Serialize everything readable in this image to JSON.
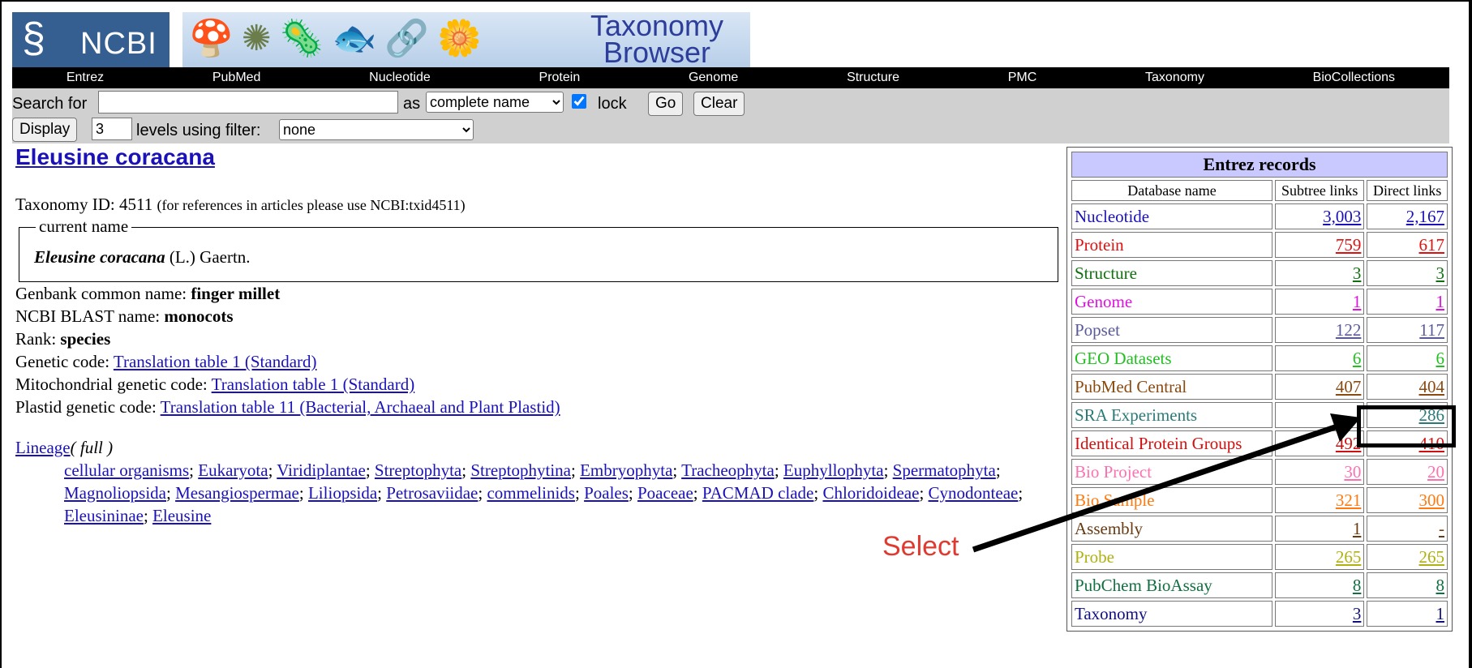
{
  "header": {
    "logo_text": "NCBI",
    "banner_title_line1": "Taxonomy",
    "banner_title_line2": "Browser"
  },
  "nav": [
    "Entrez",
    "PubMed",
    "Nucleotide",
    "Protein",
    "Genome",
    "Structure",
    "PMC",
    "Taxonomy",
    "BioCollections"
  ],
  "search": {
    "label": "Search for",
    "input_value": "",
    "as_label": "as",
    "as_select": "complete name",
    "lock_label": "lock",
    "lock_checked": true,
    "go": "Go",
    "clear": "Clear",
    "display": "Display",
    "levels_value": "3",
    "levels_label": "levels using filter:",
    "filter_select": "none"
  },
  "main": {
    "title": "Eleusine coracana",
    "taxonomy_id_label": "Taxonomy ID: 4511",
    "taxonomy_id_note": "(for references in articles please use NCBI:txid4511)",
    "current_name_legend": "current name",
    "current_name_bold": "Eleusine coracana",
    "current_name_author": "(L.) Gaertn.",
    "genbank_label": "Genbank common name: ",
    "genbank_value": "finger millet",
    "blast_label": "NCBI BLAST name: ",
    "blast_value": "monocots",
    "rank_label": "Rank: ",
    "rank_value": "species",
    "genetic_label": "Genetic code: ",
    "genetic_value": "Translation table 1 (Standard)",
    "mito_label": "Mitochondrial genetic code: ",
    "mito_value": "Translation table 1 (Standard)",
    "plastid_label": "Plastid genetic code: ",
    "plastid_value": "Translation table 11 (Bacterial, Archaeal and Plant Plastid)",
    "lineage_label": "Lineage",
    "lineage_full": "( full )",
    "lineage": [
      "cellular organisms",
      "Eukaryota",
      "Viridiplantae",
      "Streptophyta",
      "Streptophytina",
      "Embryophyta",
      "Tracheophyta",
      "Euphyllophyta",
      "Spermatophyta",
      "Magnoliopsida",
      "Mesangiospermae",
      "Liliopsida",
      "Petrosaviidae",
      "commelinids",
      "Poales",
      "Poaceae",
      "PACMAD clade",
      "Chloridoideae",
      "Cynodonteae",
      "Eleusininae",
      "Eleusine"
    ]
  },
  "entrez": {
    "title": "Entrez records",
    "col_db": "Database name",
    "col_subtree": "Subtree links",
    "col_direct": "Direct links",
    "rows": [
      {
        "name": "Nucleotide",
        "subtree": "3,003",
        "direct": "2,167",
        "color": "#1a12b8"
      },
      {
        "name": "Protein",
        "subtree": "759",
        "direct": "617",
        "color": "#e01010"
      },
      {
        "name": "Structure",
        "subtree": "3",
        "direct": "3",
        "color": "#107010"
      },
      {
        "name": "Genome",
        "subtree": "1",
        "direct": "1",
        "color": "#e010e0"
      },
      {
        "name": "Popset",
        "subtree": "122",
        "direct": "117",
        "color": "#5a5a9a"
      },
      {
        "name": "GEO Datasets",
        "subtree": "6",
        "direct": "6",
        "color": "#20c020"
      },
      {
        "name": "PubMed Central",
        "subtree": "407",
        "direct": "404",
        "color": "#8a4a10"
      },
      {
        "name": "SRA Experiments",
        "subtree": "",
        "direct": "286",
        "color": "#2a7a7a"
      },
      {
        "name": "Identical Protein Groups",
        "subtree": "492",
        "direct": "410",
        "color": "#d01010"
      },
      {
        "name": "Bio Project",
        "subtree": "30",
        "direct": "20",
        "color": "#ff70b0"
      },
      {
        "name": "Bio Sample",
        "subtree": "321",
        "direct": "300",
        "color": "#ff7a10"
      },
      {
        "name": "Assembly",
        "subtree": "1",
        "direct": "-",
        "color": "#6a3a10"
      },
      {
        "name": "Probe",
        "subtree": "265",
        "direct": "265",
        "color": "#b0b010"
      },
      {
        "name": "PubChem BioAssay",
        "subtree": "8",
        "direct": "8",
        "color": "#107040"
      },
      {
        "name": "Taxonomy",
        "subtree": "3",
        "direct": "1",
        "color": "#101080"
      }
    ]
  },
  "annotation": {
    "label": "Select"
  }
}
